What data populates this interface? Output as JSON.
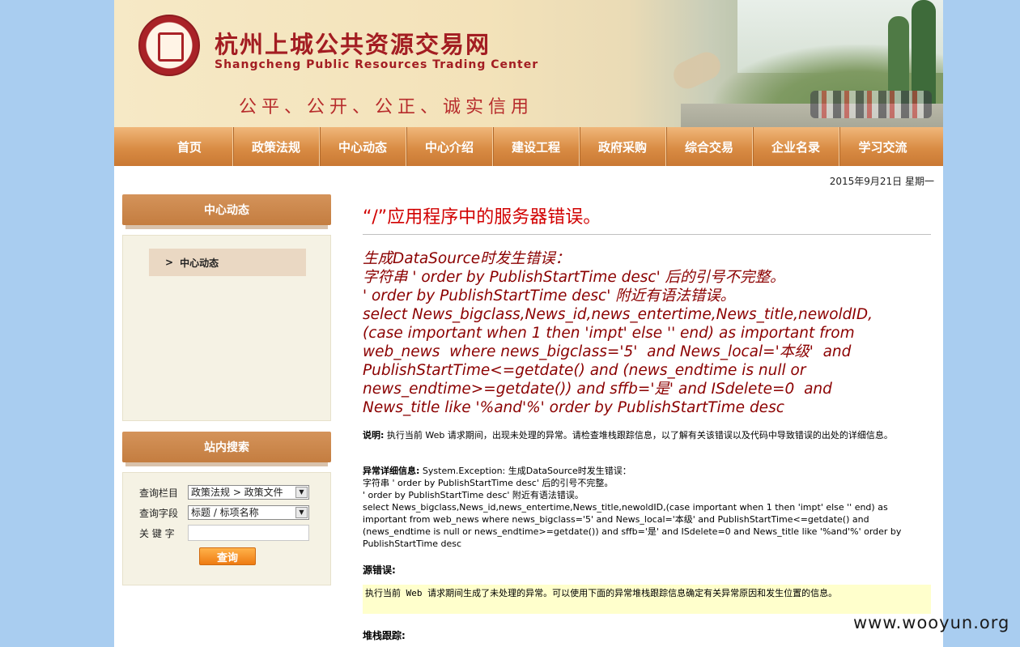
{
  "header": {
    "title_cn": "杭州上城公共资源交易网",
    "title_en": "Shangcheng Public Resources Trading Center",
    "slogan": "公平、公开、公正、诚实信用"
  },
  "nav": {
    "items": [
      "首页",
      "政策法规",
      "中心动态",
      "中心介绍",
      "建设工程",
      "政府采购",
      "综合交易",
      "企业名录",
      "学习交流"
    ]
  },
  "date": "2015年9月21日 星期一",
  "sidebar": {
    "news_title": "中心动态",
    "news_item": "中心动态",
    "search_title": "站内搜索",
    "column_label": "查询栏目",
    "column_value": "政策法规 > 政策文件",
    "field_label": "查询字段",
    "field_value": "标题 / 标项名称",
    "keyword_label": "关 键 字",
    "search_button": "查询"
  },
  "error": {
    "title": "“/”应用程序中的服务器错误。",
    "message": "生成DataSource时发生错误：\n字符串 ' order by PublishStartTime desc' 后的引号不完整。\n' order by PublishStartTime desc' 附近有语法错误。\nselect News_bigclass,News_id,news_entertime,News_title,newoldID,\n(case important when 1 then 'impt' else '' end) as important from\nweb_news  where news_bigclass='5'  and News_local='本级'  and\nPublishStartTime<=getdate() and (news_endtime is null or\nnews_endtime>=getdate()) and sffb='是' and ISdelete=0  and\nNews_title like '%and'%' order by PublishStartTime desc",
    "desc_label": "说明:",
    "desc_text": " 执行当前 Web 请求期间，出现未处理的异常。请检查堆栈跟踪信息，以了解有关该错误以及代码中导致错误的出处的详细信息。",
    "exception_label": "异常详细信息:",
    "exception_text": " System.Exception: 生成DataSource时发生错误：",
    "exception_lines": [
      "字符串 ' order by PublishStartTime desc' 后的引号不完整。",
      "' order by PublishStartTime desc' 附近有语法错误。",
      "select News_bigclass,News_id,news_entertime,News_title,newoldID,(case important when 1 then 'impt' else '' end) as",
      "important from web_news  where news_bigclass='5'  and News_local='本级'  and PublishStartTime<=getdate() and",
      "(news_endtime is null or news_endtime>=getdate()) and sffb='是' and ISdelete=0  and News_title like '%and'%' order by",
      "PublishStartTime desc"
    ],
    "source_label": "源错误:",
    "source_text": "执行当前 Web 请求期间生成了未处理的异常。可以使用下面的异常堆栈跟踪信息确定有关异常原因和发生位置的信息。",
    "stack_label": "堆栈跟踪:"
  },
  "watermark": "www.wooyun.org"
}
